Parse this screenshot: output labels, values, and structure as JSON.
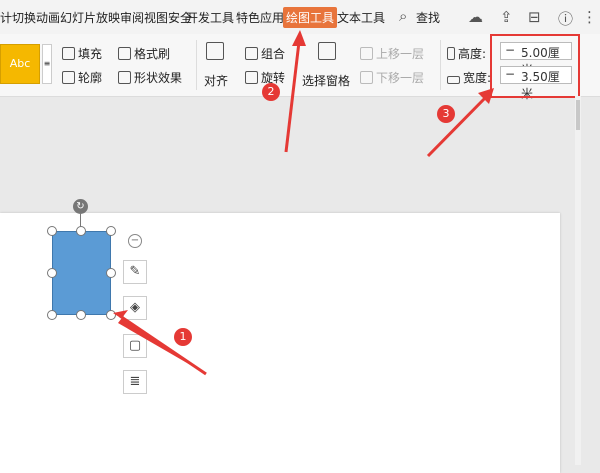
{
  "tabs": [
    "计切换动画幻灯片放映审阅视图安全",
    "开发工具",
    "特色应用",
    "绘图工具",
    "文本工具"
  ],
  "search_label": "查找",
  "ribbon": {
    "style_preview": "Abc",
    "fill": "填充",
    "format_painter": "格式刷",
    "outline": "轮廓",
    "shape_effect": "形状效果",
    "align": "对齐",
    "group": "组合",
    "rotate": "旋转",
    "selection_pane": "选择窗格",
    "bring_forward": "上移一层",
    "send_backward": "下移一层",
    "height_label": "高度:",
    "width_label": "宽度:",
    "height_value": "5.00厘米",
    "width_value": "3.50厘米"
  },
  "badges": [
    "1",
    "2",
    "3"
  ],
  "colors": {
    "accent": "#e8743b",
    "shape": "#5b9bd5",
    "annotation": "#e53935"
  }
}
